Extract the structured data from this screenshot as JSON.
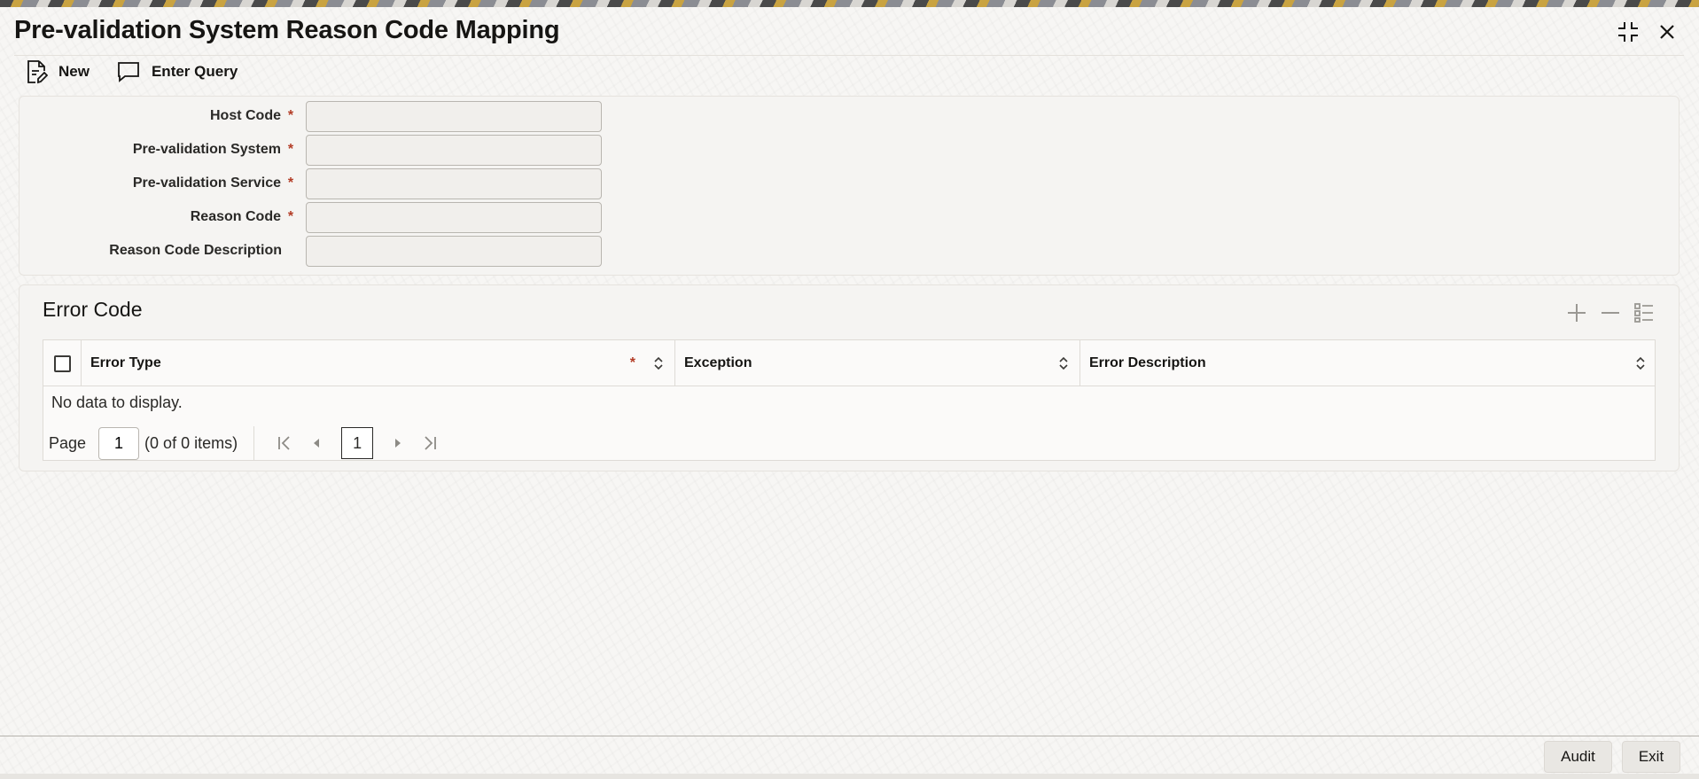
{
  "window": {
    "title": "Pre-validation System Reason Code Mapping",
    "icons": {
      "minimize": "collapse-icon",
      "close": "close-icon"
    }
  },
  "toolbar": {
    "new_label": "New",
    "new_icon": "new-document-icon",
    "query_label": "Enter Query",
    "query_icon": "chat-bubble-icon"
  },
  "form": {
    "required_marker": "*",
    "fields": [
      {
        "label": "Host Code",
        "required": true,
        "value": ""
      },
      {
        "label": "Pre-validation System",
        "required": true,
        "value": ""
      },
      {
        "label": "Pre-validation Service",
        "required": true,
        "value": ""
      },
      {
        "label": "Reason Code",
        "required": true,
        "value": ""
      },
      {
        "label": "Reason Code Description",
        "required": false,
        "value": ""
      }
    ]
  },
  "error_code": {
    "title": "Error Code",
    "actions": {
      "add": "plus-icon",
      "remove": "minus-icon",
      "columns": "list-icon"
    },
    "columns": [
      {
        "label": "Error Type",
        "required": true
      },
      {
        "label": "Exception",
        "required": false
      },
      {
        "label": "Error Description",
        "required": false
      }
    ],
    "empty_text": "No data to display.",
    "pager": {
      "page_label": "Page",
      "page_value": "1",
      "items_text": "(0 of 0 items)",
      "current_page": "1"
    }
  },
  "footer": {
    "audit_label": "Audit",
    "exit_label": "Exit"
  },
  "colors": {
    "required": "#b33c26",
    "text": "#161513",
    "background": "#f6f5f3"
  }
}
